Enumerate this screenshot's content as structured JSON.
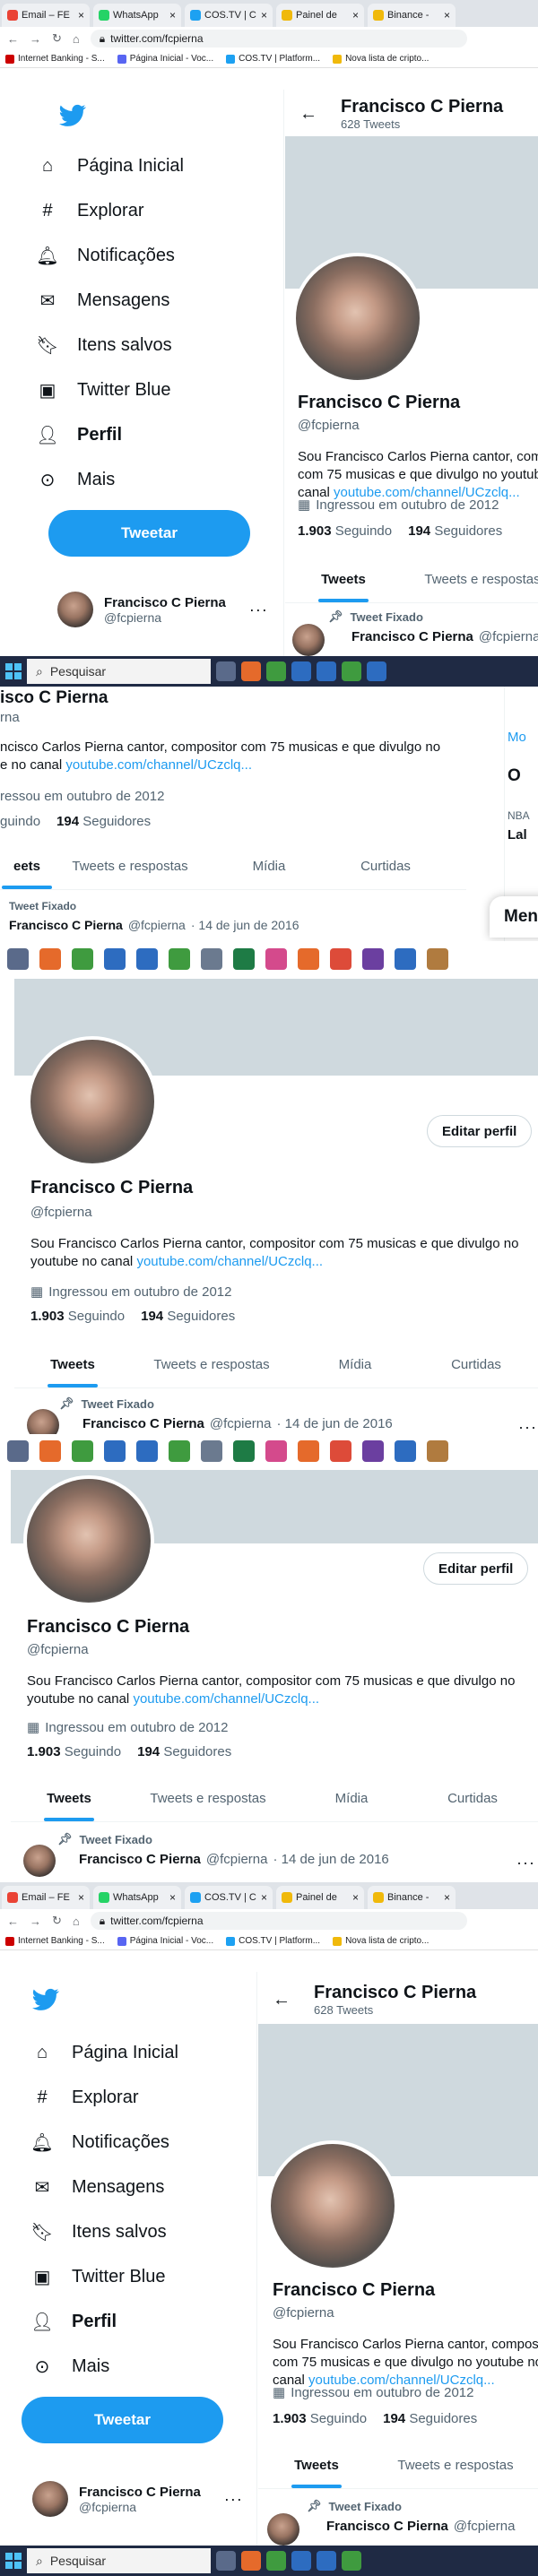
{
  "browser": {
    "tabs": [
      {
        "label": "Email – FE",
        "icon": "gmail-icon",
        "color": "#ea4335"
      },
      {
        "label": "WhatsApp",
        "icon": "whatsapp-icon",
        "color": "#25d366"
      },
      {
        "label": "COS.TV | C",
        "icon": "costv-icon",
        "color": "#1da1f2"
      },
      {
        "label": "Painel de",
        "icon": "binance-icon",
        "color": "#f0b90b"
      },
      {
        "label": "Binance -",
        "icon": "binance-icon",
        "color": "#f0b90b"
      }
    ],
    "url": "twitter.com/fcpierna",
    "bookmarks": [
      {
        "label": "Internet Banking - S...",
        "color": "#cc0000"
      },
      {
        "label": "Página Inicial - Voc...",
        "color": "#5865f2"
      },
      {
        "label": "COS.TV | Platform...",
        "color": "#1da1f2"
      },
      {
        "label": "Nova lista de cripto...",
        "color": "#f0b90b"
      }
    ]
  },
  "sidebar": {
    "items": [
      {
        "label": "Página Inicial",
        "icon": "home-icon"
      },
      {
        "label": "Explorar",
        "icon": "hashtag-icon"
      },
      {
        "label": "Notificações",
        "icon": "bell-icon"
      },
      {
        "label": "Mensagens",
        "icon": "envelope-icon"
      },
      {
        "label": "Itens salvos",
        "icon": "bookmark-icon"
      },
      {
        "label": "Twitter Blue",
        "icon": "twitter-blue-icon"
      },
      {
        "label": "Perfil",
        "icon": "person-icon",
        "active": true
      },
      {
        "label": "Mais",
        "icon": "more-circle-icon"
      }
    ],
    "tweet_button": "Tweetar",
    "account": {
      "name": "Francisco C Pierna",
      "handle": "@fcpierna"
    }
  },
  "profile": {
    "header_name": "Francisco C Pierna",
    "tweet_count": "628 Tweets",
    "name": "Francisco C Pierna",
    "handle": "@fcpierna",
    "bio_text": "Sou Francisco Carlos Pierna cantor, compositor com 75 musicas e que divulgo no youtube  no canal ",
    "bio_link": "youtube.com/channel/UCzclq...",
    "joined": "Ingressou em outubro de 2012",
    "following_count": "1.903",
    "following_label": "Seguindo",
    "followers_count": "194",
    "followers_label": "Seguidores",
    "edit_button": "Editar perfil",
    "tabs": [
      "Tweets",
      "Tweets e respostas",
      "Mídia",
      "Curtidas"
    ],
    "pinned_label": "Tweet Fixado",
    "pinned_author": "Francisco C Pierna",
    "pinned_handle": "@fcpierna",
    "pinned_date": "· 14 de jun de 2016"
  },
  "crops": {
    "bio_cut": "ncisco Carlos Pierna cantor, compositor com 75 musicas e que divulgo no",
    "name_cut": "isco C Pierna",
    "handle_cut": "rna",
    "youtube_cut": "e  no canal ",
    "joined_cut": "ressou em outubro de 2012",
    "following_cut": "guindo",
    "tab1_cut": "eets",
    "right_frag1": "Mo",
    "right_frag2": "O",
    "right_frag3": "NBA",
    "right_frag4": "Lal",
    "right_frag5": "Men"
  },
  "taskbar": {
    "search_placeholder": "Pesquisar"
  }
}
